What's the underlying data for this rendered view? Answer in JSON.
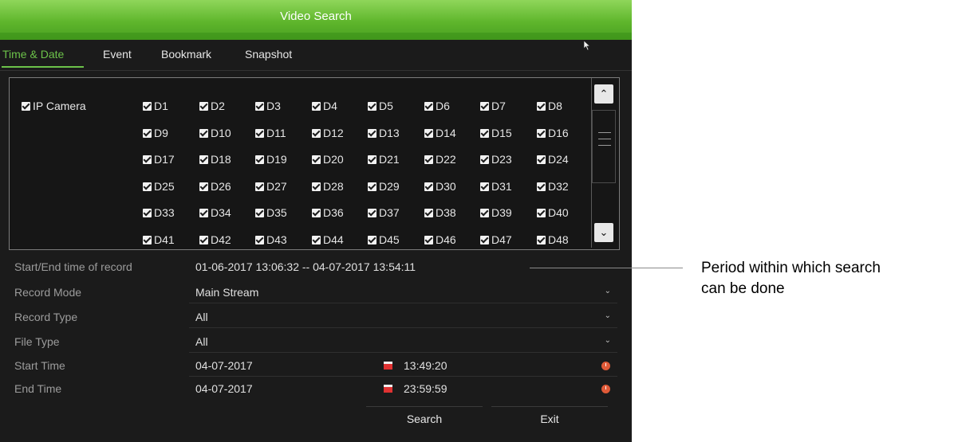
{
  "window": {
    "title": "Video Search"
  },
  "tabs": [
    {
      "label": "Time & Date",
      "active": true
    },
    {
      "label": "Event"
    },
    {
      "label": "Bookmark"
    },
    {
      "label": "Snapshot"
    }
  ],
  "camera_group": {
    "label": "IP Camera",
    "checked": true
  },
  "channels": [
    "D1",
    "D2",
    "D3",
    "D4",
    "D5",
    "D6",
    "D7",
    "D8",
    "D9",
    "D10",
    "D11",
    "D12",
    "D13",
    "D14",
    "D15",
    "D16",
    "D17",
    "D18",
    "D19",
    "D20",
    "D21",
    "D22",
    "D23",
    "D24",
    "D25",
    "D26",
    "D27",
    "D28",
    "D29",
    "D30",
    "D31",
    "D32",
    "D33",
    "D34",
    "D35",
    "D36",
    "D37",
    "D38",
    "D39",
    "D40",
    "D41",
    "D42",
    "D43",
    "D44",
    "D45",
    "D46",
    "D47",
    "D48"
  ],
  "fields": {
    "record_range": {
      "label": "Start/End time of record",
      "value": "01-06-2017 13:06:32 -- 04-07-2017 13:54:11"
    },
    "record_mode": {
      "label": "Record Mode",
      "value": "Main Stream"
    },
    "record_type": {
      "label": "Record Type",
      "value": "All"
    },
    "file_type": {
      "label": "File Type",
      "value": "All"
    },
    "start_time": {
      "label": "Start Time",
      "date": "04-07-2017",
      "time": "13:49:20"
    },
    "end_time": {
      "label": "End Time",
      "date": "04-07-2017",
      "time": "23:59:59"
    }
  },
  "buttons": {
    "search": "Search",
    "exit": "Exit"
  },
  "annotation": {
    "line1": "Period within which search",
    "line2": "can be done"
  },
  "colors": {
    "title_green": "#5fb62c",
    "active_tab": "#6cc24a",
    "panel_bg": "#1b1b1b"
  }
}
